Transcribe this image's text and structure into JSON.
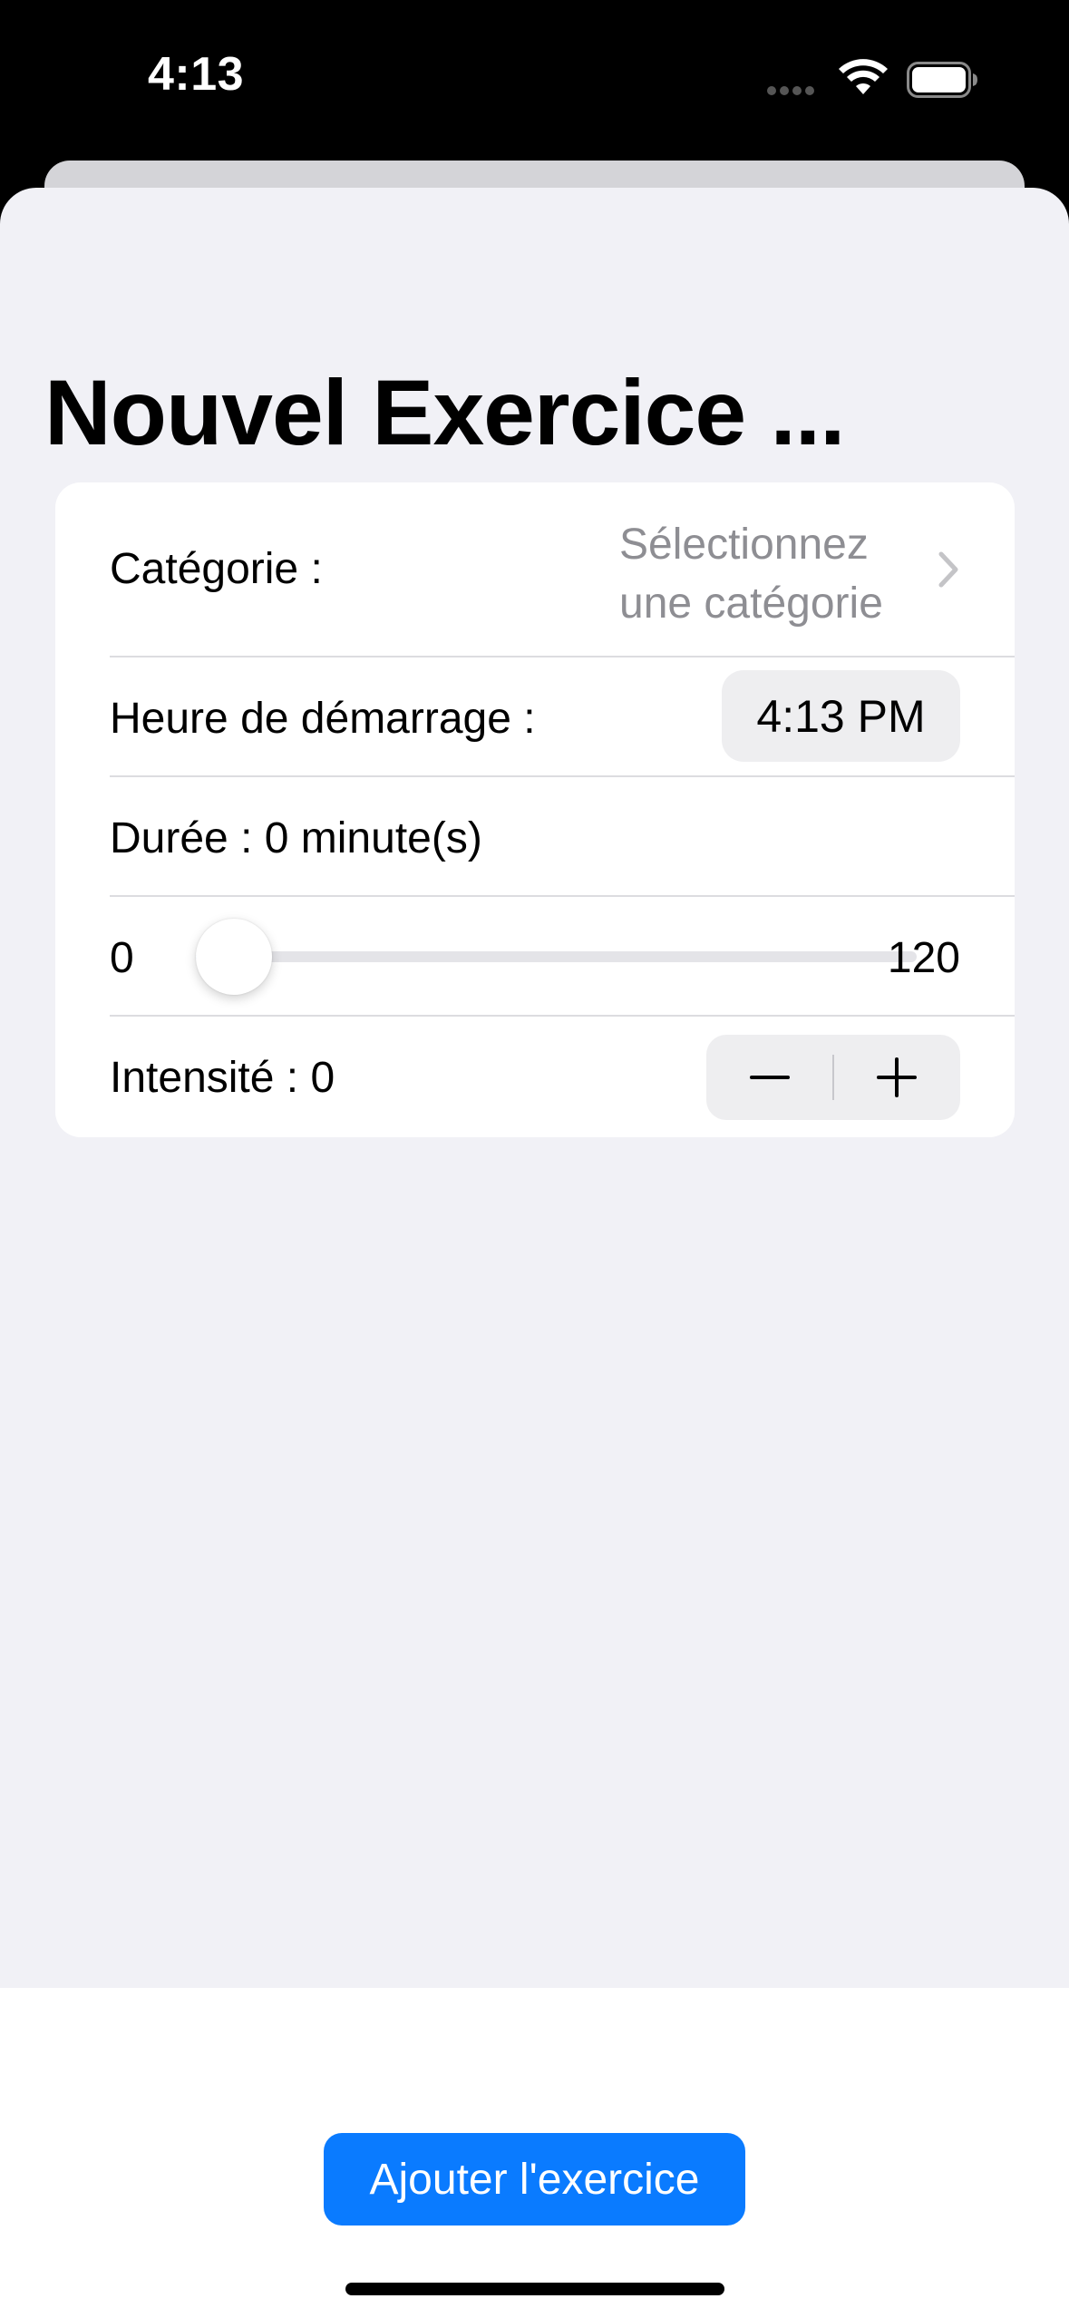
{
  "status_bar": {
    "time": "4:13",
    "icons": [
      "signal-icon",
      "wifi-icon",
      "battery-icon"
    ]
  },
  "page": {
    "title": "Nouvel Exercice ..."
  },
  "form": {
    "category": {
      "label": "Catégorie :",
      "value": "Sélectionnez une catégorie",
      "icon": "chevron-right-icon"
    },
    "start_time": {
      "label": "Heure de démarrage :",
      "value": "4:13 PM"
    },
    "duration": {
      "label": "Durée : 0 minute(s)",
      "value": 0
    },
    "slider": {
      "min_label": "0",
      "max_label": "120",
      "min": 0,
      "max": 120,
      "value": 0
    },
    "intensity": {
      "label": "Intensité : 0",
      "minus_icon": "minus-icon",
      "plus_icon": "plus-icon"
    }
  },
  "actions": {
    "add_label": "Ajouter l'exercice"
  },
  "colors": {
    "accent": "#0A7BFF",
    "background": "#F1F1F6",
    "secondary_text": "#8E8E93"
  }
}
